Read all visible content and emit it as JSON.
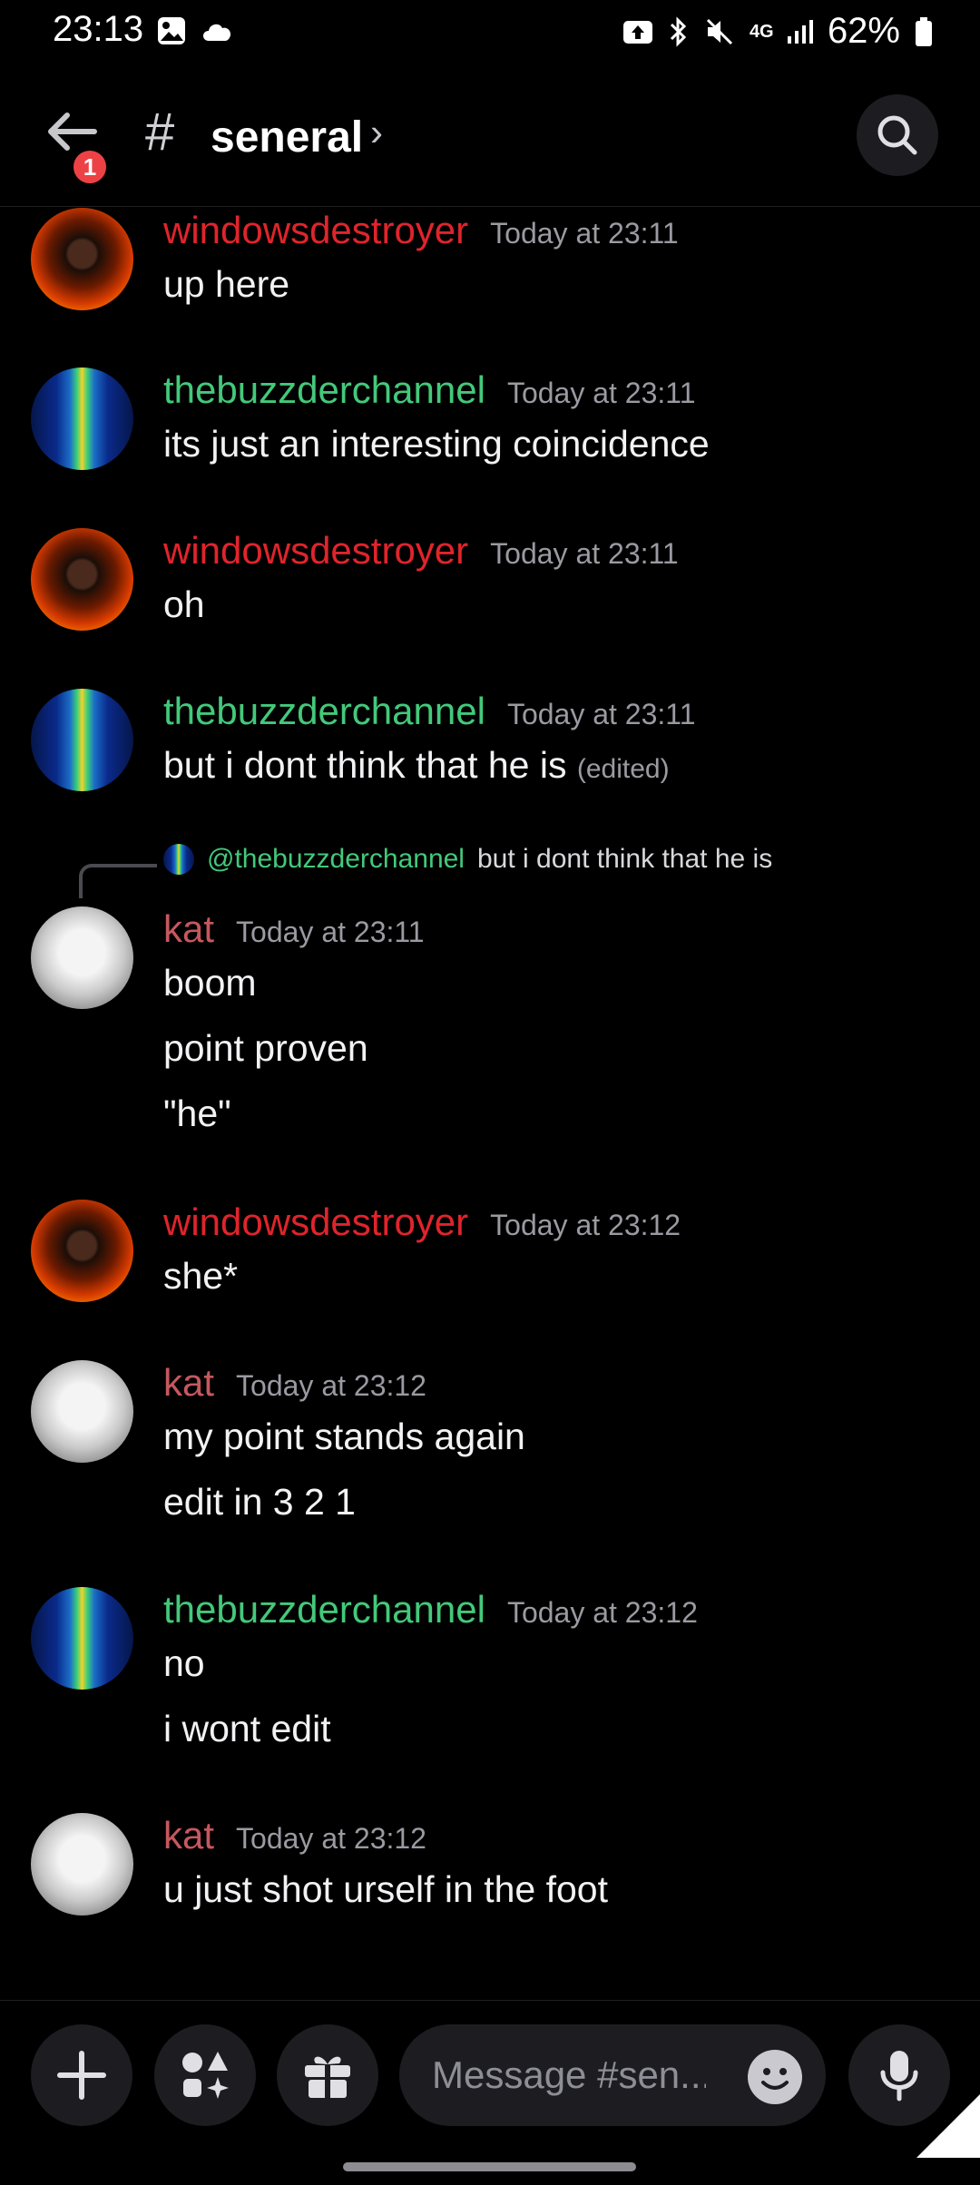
{
  "status_bar": {
    "time": "23:13",
    "battery": "62%",
    "network": "4G",
    "left_icons": [
      "gallery-icon",
      "cloud-icon"
    ],
    "right_icons": [
      "upload-icon",
      "bluetooth-icon",
      "mute-icon",
      "4g-icon",
      "signal-icon",
      "battery-icon"
    ]
  },
  "header": {
    "badge": "1",
    "hash": "#",
    "channel": "seneral",
    "chevron": "›"
  },
  "colors": {
    "background": "#000000",
    "windowsdestroyer": "#e0242b",
    "thebuzzderchannel": "#43c97a",
    "kat": "#c5585e",
    "timestamp": "#9a9aa2",
    "badge": "#ed4245"
  },
  "messages": [
    {
      "user": "windowsdestroyer",
      "time": "Today at 23:11",
      "lines": [
        "up here"
      ]
    },
    {
      "user": "thebuzzderchannel",
      "time": "Today at 23:11",
      "lines": [
        "its just an interesting coincidence"
      ]
    },
    {
      "user": "windowsdestroyer",
      "time": "Today at 23:11",
      "lines": [
        "oh"
      ]
    },
    {
      "user": "thebuzzderchannel",
      "time": "Today at 23:11",
      "lines": [
        "but i dont think that he is"
      ],
      "edited": "(edited)"
    },
    {
      "user": "kat",
      "time": "Today at 23:11",
      "reply_user": "@thebuzzderchannel",
      "reply_text": "but i dont think that he is",
      "lines": [
        "boom",
        "point proven",
        "\"he\""
      ]
    },
    {
      "user": "windowsdestroyer",
      "time": "Today at 23:12",
      "lines": [
        "she*"
      ]
    },
    {
      "user": "kat",
      "time": "Today at 23:12",
      "lines": [
        "my point stands again",
        "edit in 3 2 1"
      ]
    },
    {
      "user": "thebuzzderchannel",
      "time": "Today at 23:12",
      "lines": [
        "no",
        "i wont edit"
      ]
    },
    {
      "user": "kat",
      "time": "Today at 23:12",
      "lines": [
        "u just shot urself in the foot"
      ]
    }
  ],
  "composer": {
    "placeholder": "Message #sen...",
    "buttons": [
      "plus-icon",
      "apps-icon",
      "gift-icon",
      "emoji-icon",
      "mic-icon"
    ]
  }
}
